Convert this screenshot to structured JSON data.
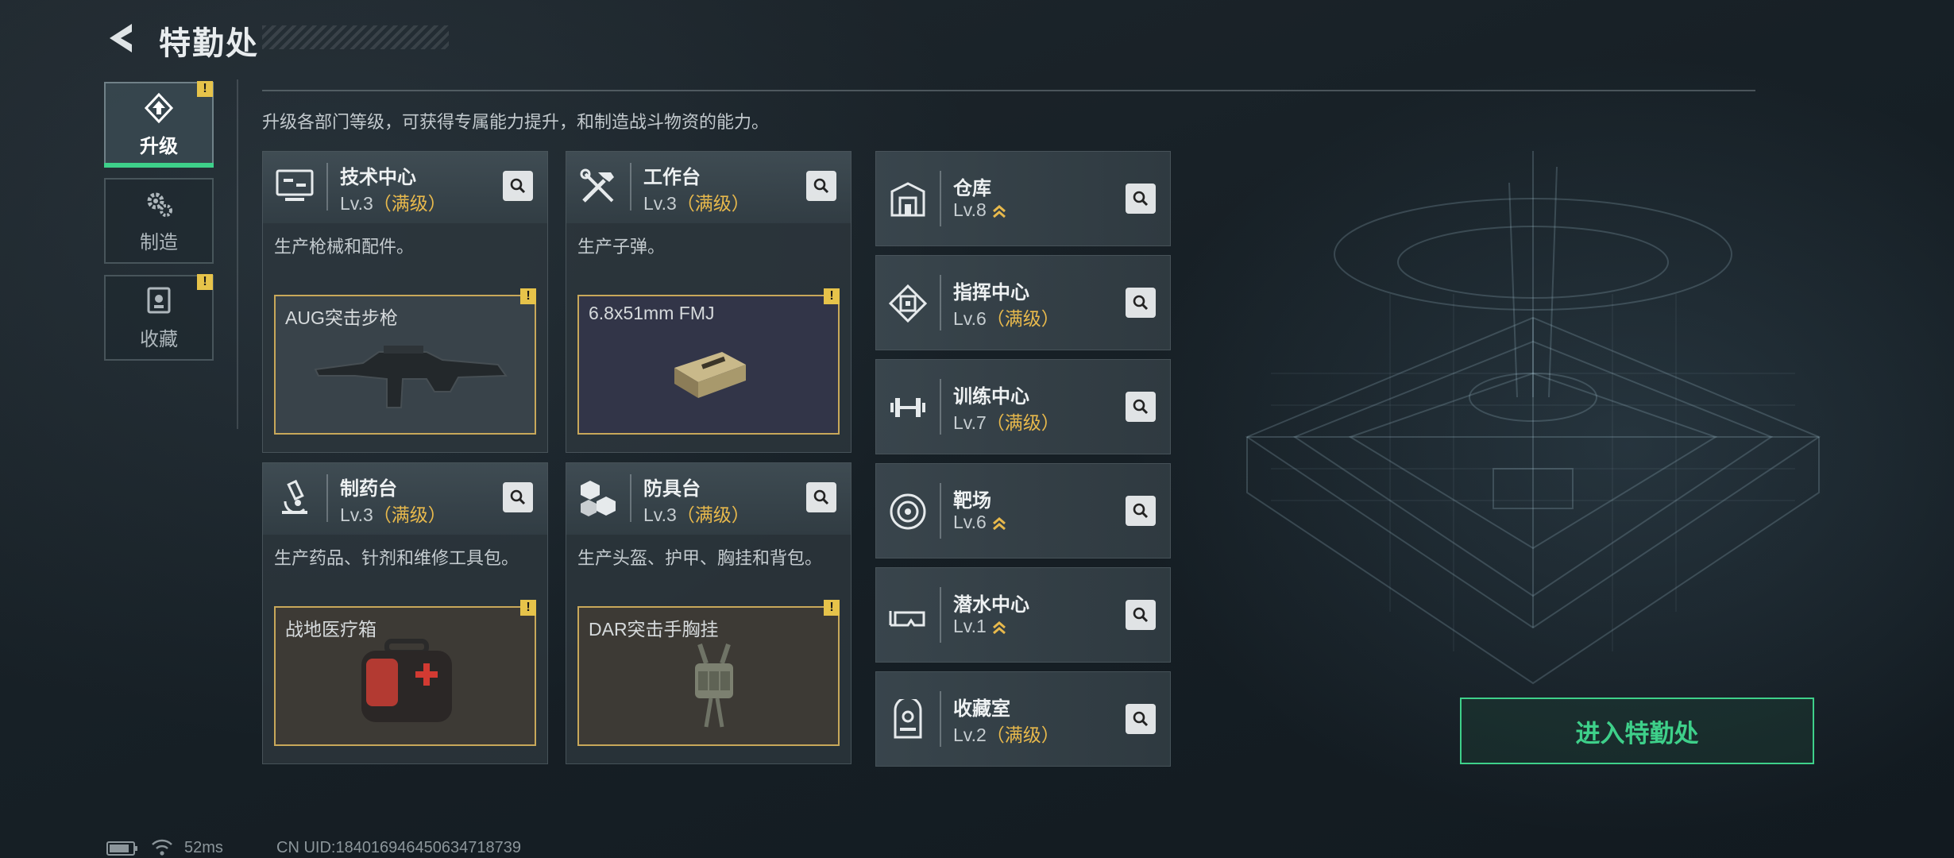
{
  "header": {
    "title": "特勤处"
  },
  "nav": [
    {
      "label": "升级",
      "icon": "upgrade-icon",
      "active": true,
      "alert": "!"
    },
    {
      "label": "制造",
      "icon": "gear-icon",
      "active": false
    },
    {
      "label": "收藏",
      "icon": "trophy-icon",
      "active": false,
      "alert": "!"
    }
  ],
  "subtitle": "升级各部门等级，可获得专属能力提升，和制造战斗物资的能力。",
  "workshops": [
    {
      "name": "技术中心",
      "level": "Lv.3",
      "max": "（满级）",
      "icon": "monitor-icon",
      "desc": "生产枪械和配件。",
      "product": "AUG突击步枪",
      "alert": "!"
    },
    {
      "name": "工作台",
      "level": "Lv.3",
      "max": "（满级）",
      "icon": "tools-icon",
      "desc": "生产子弹。",
      "product": "6.8x51mm FMJ",
      "alert": "!"
    },
    {
      "name": "制药台",
      "level": "Lv.3",
      "max": "（满级）",
      "icon": "microscope-icon",
      "desc": "生产药品、针剂和维修工具包。",
      "product": "战地医疗箱",
      "alert": "!"
    },
    {
      "name": "防具台",
      "level": "Lv.3",
      "max": "（满级）",
      "icon": "cubes-icon",
      "desc": "生产头盔、护甲、胸挂和背包。",
      "product": "DAR突击手胸挂",
      "alert": "!"
    }
  ],
  "facilities": [
    {
      "name": "仓库",
      "level": "Lv.8",
      "max": "",
      "upgradable": true,
      "icon": "warehouse-icon"
    },
    {
      "name": "指挥中心",
      "level": "Lv.6",
      "max": "（满级）",
      "upgradable": false,
      "icon": "chip-icon"
    },
    {
      "name": "训练中心",
      "level": "Lv.7",
      "max": "（满级）",
      "upgradable": false,
      "icon": "dumbbell-icon"
    },
    {
      "name": "靶场",
      "level": "Lv.6",
      "max": "",
      "upgradable": true,
      "icon": "target-icon"
    },
    {
      "name": "潜水中心",
      "level": "Lv.1",
      "max": "",
      "upgradable": true,
      "icon": "diving-mask-icon"
    },
    {
      "name": "收藏室",
      "level": "Lv.2",
      "max": "（满级）",
      "upgradable": false,
      "icon": "collection-icon"
    }
  ],
  "enter_button": "进入特勤处",
  "status": {
    "ping": "52ms",
    "uid": "CN UID:184016946450634718739"
  },
  "colors": {
    "accent": "#3ed08a",
    "max_level": "#e8b94c",
    "warning": "#e6c34a",
    "product_border": "#c8a85a"
  }
}
